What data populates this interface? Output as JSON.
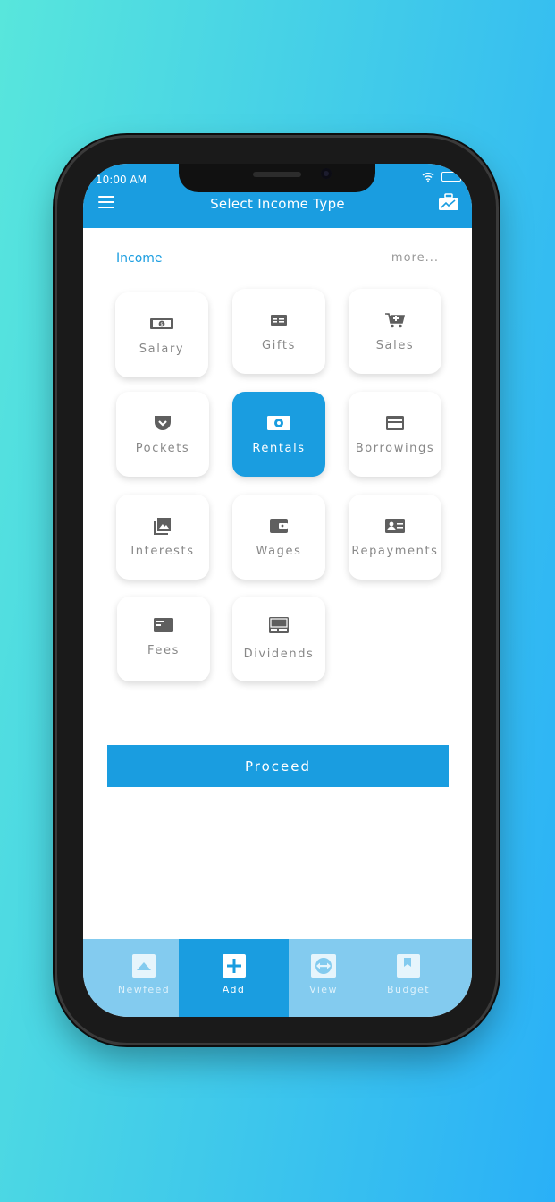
{
  "status_bar": {
    "time": "10:00 AM"
  },
  "header": {
    "title": "Select Income Type"
  },
  "section": {
    "label": "Income",
    "more": "more..."
  },
  "tiles": [
    {
      "label": "Salary",
      "icon": "money-bill-icon"
    },
    {
      "label": "Gifts",
      "icon": "cheque-icon"
    },
    {
      "label": "Sales",
      "icon": "cart-icon"
    },
    {
      "label": "Pockets",
      "icon": "pocket-icon"
    },
    {
      "label": "Rentals",
      "icon": "eye-card-icon",
      "selected": true
    },
    {
      "label": "Borrowings",
      "icon": "credit-card-icon"
    },
    {
      "label": "Interests",
      "icon": "photo-library-icon"
    },
    {
      "label": "Wages",
      "icon": "wallet-icon"
    },
    {
      "label": "Repayments",
      "icon": "id-card-icon"
    },
    {
      "label": "Fees",
      "icon": "card-icon"
    },
    {
      "label": "Dividends",
      "icon": "card-reader-icon"
    }
  ],
  "proceed_label": "Proceed",
  "tabs": [
    {
      "label": "Newfeed",
      "icon": "newsfeed-icon"
    },
    {
      "label": "Add",
      "icon": "add-box-icon",
      "active": true
    },
    {
      "label": "View",
      "icon": "swap-eye-icon"
    },
    {
      "label": "Budget",
      "icon": "bookmark-icon"
    }
  ],
  "colors": {
    "accent": "#1a9de0",
    "tabbar": "#83cbef",
    "icon_gray": "#5f5f5f"
  }
}
